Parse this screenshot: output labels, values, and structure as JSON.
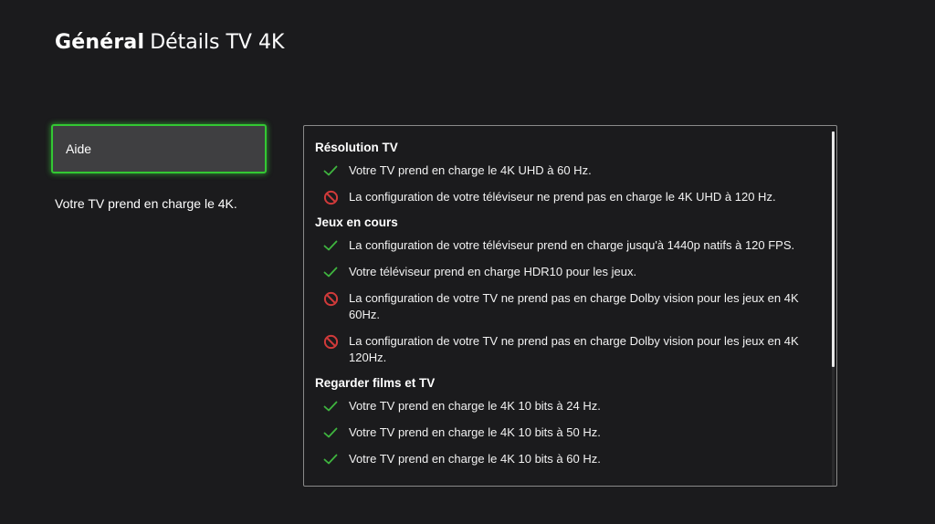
{
  "header": {
    "breadcrumb": "Général",
    "title": "Détails TV 4K"
  },
  "sidebar": {
    "help_button_label": "Aide",
    "description": "Votre TV prend en charge le 4K."
  },
  "sections": [
    {
      "title": "Résolution TV",
      "items": [
        {
          "status": "supported",
          "icon": "check-icon",
          "text": "Votre TV prend en charge le 4K UHD à 60 Hz."
        },
        {
          "status": "unsupported",
          "icon": "prohibited-icon",
          "text": "La configuration de votre téléviseur ne prend pas en charge le 4K UHD à 120 Hz."
        }
      ]
    },
    {
      "title": "Jeux en cours",
      "items": [
        {
          "status": "supported",
          "icon": "check-icon",
          "text": "La configuration de votre téléviseur prend en charge jusqu'à 1440p natifs à 120 FPS."
        },
        {
          "status": "supported",
          "icon": "check-icon",
          "text": "Votre téléviseur prend en charge HDR10 pour les jeux."
        },
        {
          "status": "unsupported",
          "icon": "prohibited-icon",
          "text": "La configuration de votre TV ne prend pas en charge Dolby vision pour les jeux en 4K 60Hz."
        },
        {
          "status": "unsupported",
          "icon": "prohibited-icon",
          "text": "La configuration de votre TV ne prend pas en charge Dolby vision pour les jeux en 4K 120Hz."
        }
      ]
    },
    {
      "title": "Regarder films et TV",
      "items": [
        {
          "status": "supported",
          "icon": "check-icon",
          "text": "Votre TV prend en charge le 4K 10 bits à 24 Hz."
        },
        {
          "status": "supported",
          "icon": "check-icon",
          "text": "Votre TV prend en charge le 4K 10 bits à 50 Hz."
        },
        {
          "status": "supported",
          "icon": "check-icon",
          "text": "Votre TV prend en charge le 4K 10 bits à 60 Hz."
        }
      ]
    }
  ],
  "colors": {
    "background": "#1b1b1d",
    "focus_green": "#33c833",
    "check_green": "#3fb53f",
    "prohibited_red": "#d03a3a"
  }
}
